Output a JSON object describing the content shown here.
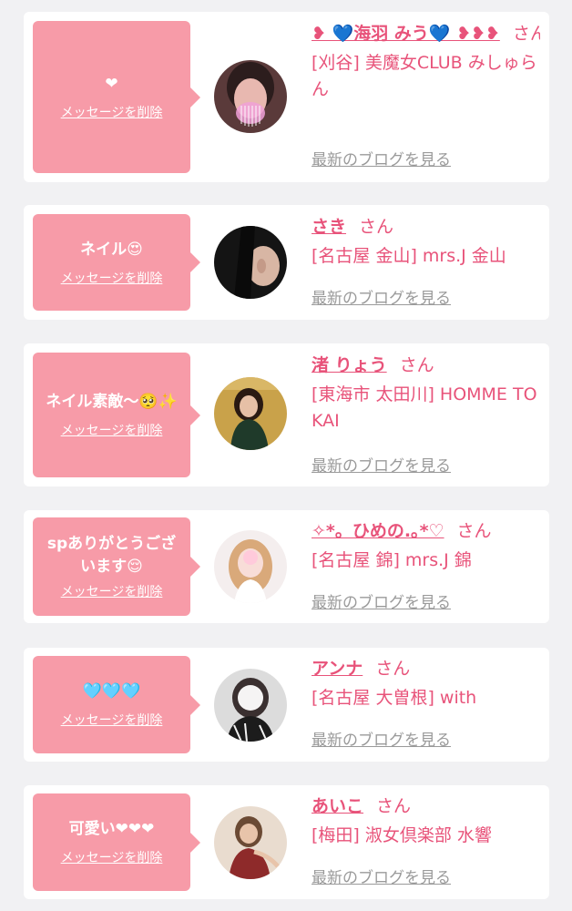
{
  "colors": {
    "page_bg": "#f1f1f3",
    "card_bg": "#ffffff",
    "bubble_bg": "#f79ba8",
    "accent": "#e8537a",
    "link_gray": "#9a9a9a"
  },
  "labels": {
    "delete": "メッセージを削除",
    "blog": "最新のブログを見る",
    "honorific": "さん"
  },
  "messages": [
    {
      "message": "❤",
      "name": "❥ 💙海羽 みう💙 ❥❥❥",
      "shop": "[刈谷] 美魔女CLUB みしゅらん",
      "avatar_icon": "woman-photo-pink-mask"
    },
    {
      "message": "ネイル😍",
      "name": "さき",
      "shop": "[名古屋 金山] mrs.J 金山",
      "avatar_icon": "woman-photo-dark"
    },
    {
      "message": "ネイル素敵〜🥺✨",
      "name": "渚 りょう",
      "shop": "[東海市 太田川] HOMME TOKAI",
      "avatar_icon": "woman-photo-gold"
    },
    {
      "message": "spありがとうございます😌",
      "name": "✧*。ひめの.｡*♡",
      "shop": "[名古屋 錦] mrs.J 錦",
      "avatar_icon": "woman-photo-blonde"
    },
    {
      "message": "🩵🩵🩵",
      "name": "アンナ",
      "shop": "[名古屋 大曽根] with",
      "avatar_icon": "woman-photo-blur"
    },
    {
      "message": "可愛い❤❤❤",
      "name": "あいこ",
      "shop": "[梅田] 淑女倶楽部 水響",
      "avatar_icon": "woman-photo-red-dress"
    }
  ]
}
